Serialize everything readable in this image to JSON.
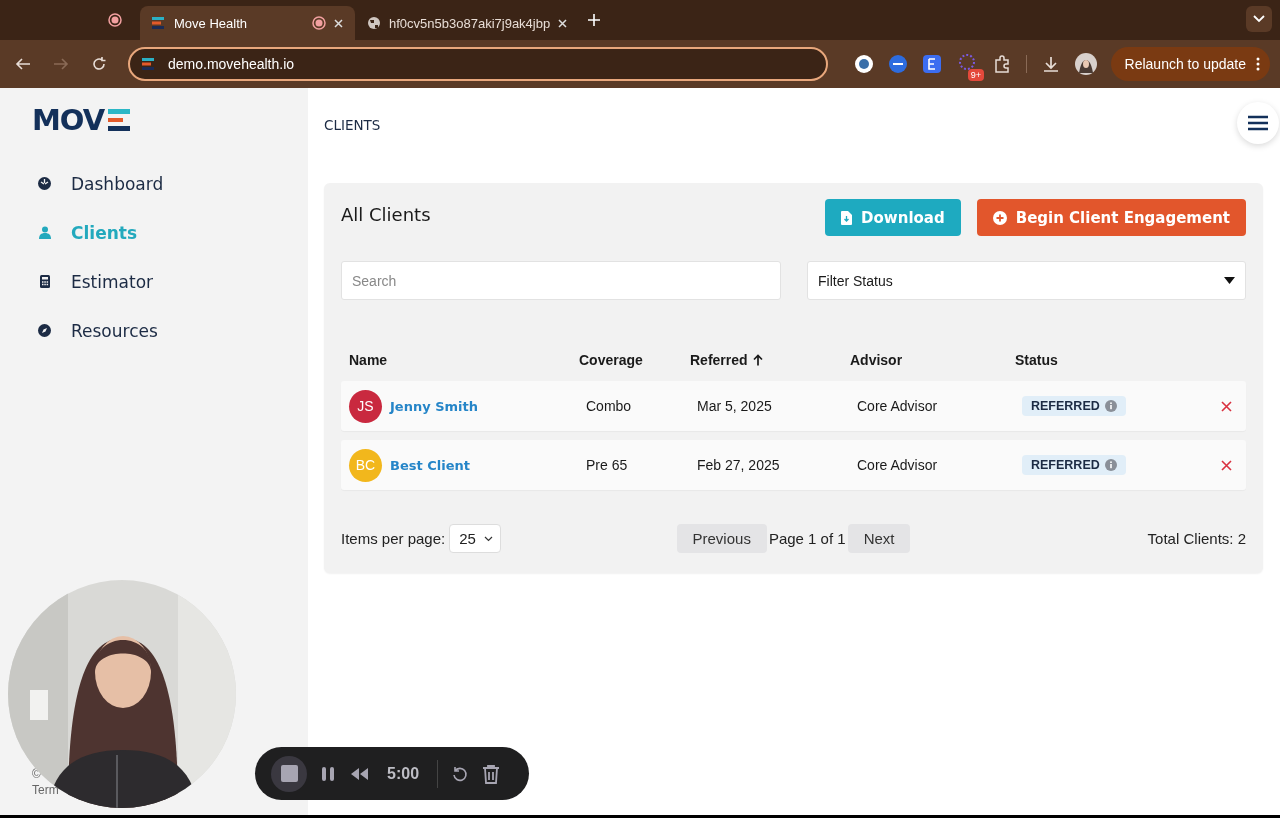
{
  "browser": {
    "tabs": [
      {
        "title": "Move Health",
        "selected": true,
        "recording": true
      },
      {
        "title": "hf0cv5n5b3o87aki7j9ak4jbp",
        "selected": false,
        "recording": false
      }
    ],
    "address": "demo.movehealth.io",
    "extension_badge": "9+",
    "relaunch": "Relaunch to update"
  },
  "sidebar": {
    "logo": "MOV",
    "items": [
      {
        "label": "Dashboard",
        "selected": false
      },
      {
        "label": "Clients",
        "selected": true
      },
      {
        "label": "Estimator",
        "selected": false
      },
      {
        "label": "Resources",
        "selected": false
      }
    ],
    "footer": [
      "©",
      "Term"
    ]
  },
  "page_title": "CLIENTS",
  "panel": {
    "title": "All Clients",
    "buttons": [
      {
        "label": "Download",
        "kind": "download"
      },
      {
        "label": "Begin Client Engagement",
        "kind": "engage"
      }
    ],
    "search": {
      "placeholder": "Search"
    },
    "filter": {
      "value": "Filter Status"
    },
    "columns": [
      {
        "label": "Name",
        "sorted": false
      },
      {
        "label": "Coverage",
        "sorted": false
      },
      {
        "label": "Referred",
        "sorted": true
      },
      {
        "label": "Advisor",
        "sorted": false
      },
      {
        "label": "Status",
        "sorted": false
      }
    ],
    "rows": [
      {
        "initials": "JS",
        "color": "#c9293f",
        "name": "Jenny Smith",
        "coverage": "Combo",
        "referred": "Mar 5, 2025",
        "advisor": "Core Advisor",
        "status": "REFERRED"
      },
      {
        "initials": "BC",
        "color": "#f2b71c",
        "name": "Best Client",
        "coverage": "Pre 65",
        "referred": "Feb 27, 2025",
        "advisor": "Core Advisor",
        "status": "REFERRED"
      }
    ],
    "items_per_page_label": "Items per page:",
    "items_per_page": "25",
    "previous": "Previous",
    "page_info": "Page 1 of 1",
    "next": "Next",
    "total": "Total Clients: 2"
  },
  "recorder": {
    "time": "5:00"
  }
}
